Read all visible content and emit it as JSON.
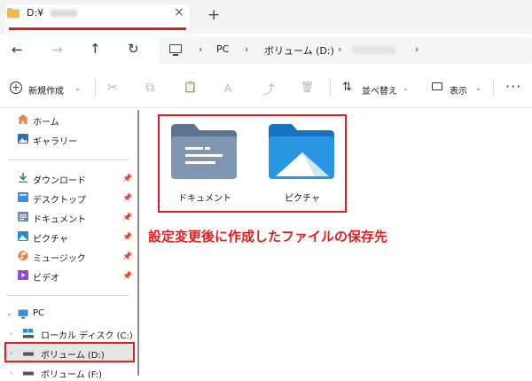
{
  "tab": {
    "title": "D:¥",
    "close_icon": "×",
    "new_tab_icon": "+"
  },
  "nav": {
    "back_icon": "←",
    "forward_icon": "→",
    "up_icon": "↑",
    "refresh_icon": "↻"
  },
  "breadcrumb": {
    "sep": "›",
    "items": [
      "PC",
      "ボリューム (D:)"
    ]
  },
  "toolbar": {
    "new_label": "新規作成",
    "chevron": "⌄",
    "cut_icon": "✂",
    "copy_icon": "⧉",
    "paste_icon": "📋",
    "rename_icon": "Ａ",
    "share_icon": "⤴",
    "delete_icon": "🗑",
    "sort_icon": "⇅",
    "sort_label": "並べ替え",
    "view_label": "表示",
    "more_icon": "···"
  },
  "sidebar": {
    "pin_icon": "📌",
    "items": [
      {
        "label": "ホーム",
        "icon": "home-icon"
      },
      {
        "label": "ギャラリー",
        "icon": "gallery-icon"
      },
      {
        "label": "ダウンロード",
        "icon": "download-icon",
        "pinned": true
      },
      {
        "label": "デスクトップ",
        "icon": "desktop-icon",
        "pinned": true
      },
      {
        "label": "ドキュメント",
        "icon": "documents-icon",
        "pinned": true
      },
      {
        "label": "ピクチャ",
        "icon": "pictures-icon",
        "pinned": true
      },
      {
        "label": "ミュージック",
        "icon": "music-icon",
        "pinned": true
      },
      {
        "label": "ビデオ",
        "icon": "videos-icon",
        "pinned": true
      },
      {
        "label": "PC",
        "icon": "pc-icon"
      },
      {
        "label": "ローカル ディスク (C:)",
        "icon": "drive-c-icon"
      },
      {
        "label": "ボリューム (D:)",
        "icon": "drive-d-icon",
        "selected": true
      },
      {
        "label": "ボリューム (F:)",
        "icon": "drive-f-icon"
      }
    ]
  },
  "content": {
    "folders": [
      {
        "label": "ドキュメント",
        "icon": "documents-folder-icon"
      },
      {
        "label": "ピクチャ",
        "icon": "pictures-folder-icon"
      }
    ],
    "annotation": "設定変更後に作成したファイルの保存先"
  },
  "colors": {
    "highlight": "#e02020",
    "folder_blue": "#1f8fd6",
    "folder_gray": "#6f8aa8"
  }
}
